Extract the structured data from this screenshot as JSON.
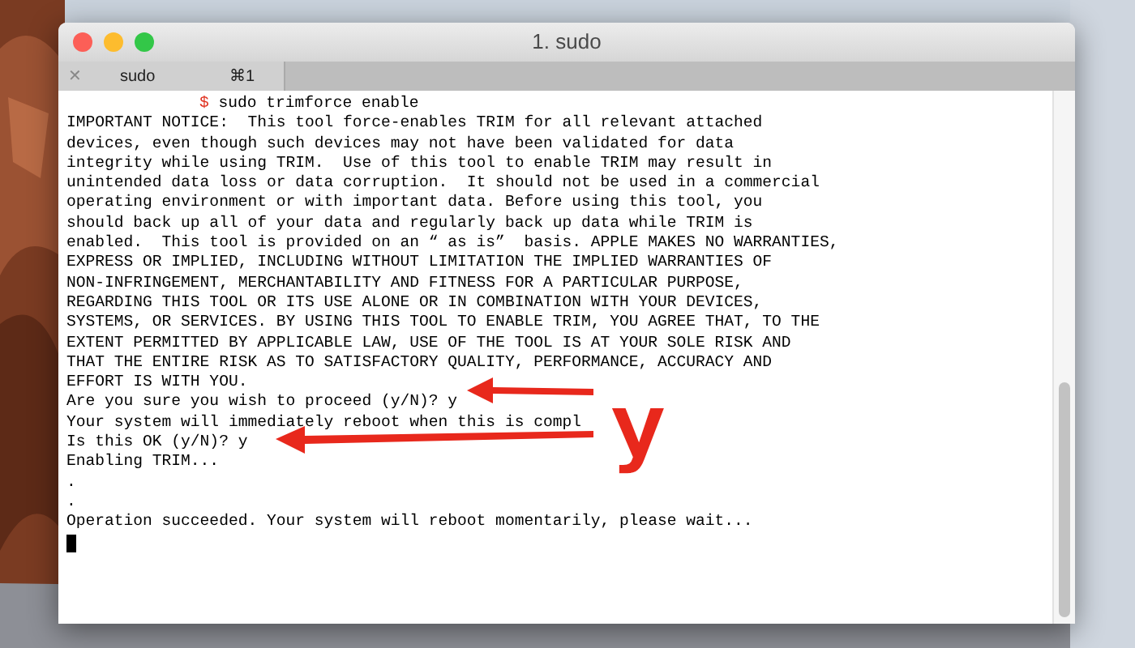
{
  "window": {
    "title": "1. sudo"
  },
  "tab": {
    "close": "✕",
    "label": "sudo",
    "shortcut": "⌘1",
    "selected": true
  },
  "prompt": {
    "symbol": "$",
    "command": "sudo trimforce enable"
  },
  "lines": [
    "IMPORTANT NOTICE:  This tool force-enables TRIM for all relevant attached",
    "devices, even though such devices may not have been validated for data",
    "integrity while using TRIM.  Use of this tool to enable TRIM may result in",
    "unintended data loss or data corruption.  It should not be used in a commercial",
    "operating environment or with important data. Before using this tool, you",
    "should back up all of your data and regularly back up data while TRIM is",
    "enabled.  This tool is provided on an “ as is”  basis. APPLE MAKES NO WARRANTIES,",
    "EXPRESS OR IMPLIED, INCLUDING WITHOUT LIMITATION THE IMPLIED WARRANTIES OF",
    "NON-INFRINGEMENT, MERCHANTABILITY AND FITNESS FOR A PARTICULAR PURPOSE,",
    "REGARDING THIS TOOL OR ITS USE ALONE OR IN COMBINATION WITH YOUR DEVICES,",
    "SYSTEMS, OR SERVICES. BY USING THIS TOOL TO ENABLE TRIM, YOU AGREE THAT, TO THE",
    "EXTENT PERMITTED BY APPLICABLE LAW, USE OF THE TOOL IS AT YOUR SOLE RISK AND",
    "THAT THE ENTIRE RISK AS TO SATISFACTORY QUALITY, PERFORMANCE, ACCURACY AND",
    "EFFORT IS WITH YOU.",
    "Are you sure you wish to proceed (y/N)? y",
    "Your system will immediately reboot when this is compl",
    "Is this OK (y/N)? y",
    "Enabling TRIM...",
    ".",
    ".",
    "Operation succeeded. Your system will reboot momentarily, please wait..."
  ],
  "annotation": {
    "letter": "y"
  }
}
